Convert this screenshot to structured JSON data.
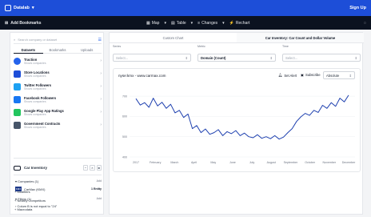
{
  "topbar": {
    "brand": "Datalab",
    "signup": "Sign Up"
  },
  "toolbar": {
    "add_bookmarks": "Add Bookmarks",
    "map": "Map",
    "table": "Table",
    "changes": "Changes",
    "rechart": "Rechart"
  },
  "left": {
    "search_placeholder": "Search company or dataset",
    "tabs": [
      "Datasets",
      "Bookmarks",
      "Uploads"
    ],
    "datasets": [
      {
        "title": "Traction",
        "sub": "Shows companies",
        "color": "#2563eb",
        "icon": "traction-icon"
      },
      {
        "title": "Store Locations",
        "sub": "Shows companies",
        "color": "#1d4ed8",
        "icon": "store-location-icon"
      },
      {
        "title": "Twitter Followers",
        "sub": "Shows companies",
        "color": "#1da1f2",
        "icon": "twitter-icon"
      },
      {
        "title": "Facebook Followers",
        "sub": "Shows companies",
        "color": "#1877f2",
        "icon": "facebook-icon"
      },
      {
        "title": "Google Play App Ratings",
        "sub": "Shows companies",
        "color": "#22c55e",
        "icon": "google-play-icon"
      },
      {
        "title": "Government Contracts",
        "sub": "Shows companies",
        "color": "#475569",
        "icon": "government-icon"
      }
    ],
    "current": {
      "title": "Car Inventory"
    },
    "companies_label": "Companies (1)",
    "add": "Add",
    "company_ticker": "KMX",
    "company_name": "CarMax (KMX)",
    "company_count": "1 Entity",
    "filters_label": "Filters (1)",
    "filter_rule": "Colum B is not equal to \"24\"",
    "modifiers": "Modifiers",
    "nearby": "Nearby Competitors",
    "macro": "Macrodata"
  },
  "main": {
    "tabs": [
      "Custom Chart",
      "Car Inventory: Car Count and Dollar Volume"
    ],
    "series_label": "Series",
    "metric_label": "Metric",
    "time_label": "Time",
    "series_value": "Select...",
    "metric_value": "Domain (Count)",
    "time_value": "Select...",
    "chart_title": "nyse:kmx - www.carmax.com",
    "set_alert": "Set Alert",
    "subscribe": "Subscribe",
    "mode": "Absolute"
  },
  "chart_data": {
    "type": "line",
    "x": [
      "2017",
      "February",
      "March",
      "April",
      "May",
      "June",
      "July",
      "August",
      "September",
      "October",
      "November",
      "December"
    ],
    "yticks": [
      400,
      500,
      600,
      700
    ],
    "ylim": [
      400,
      740
    ],
    "color": "#1e40af",
    "values": [
      688,
      656,
      668,
      645,
      690,
      652,
      670,
      640,
      660,
      618,
      630,
      595,
      612,
      540,
      555,
      520,
      538,
      512,
      520,
      535,
      505,
      525,
      515,
      530,
      505,
      518,
      500,
      495,
      510,
      492,
      500,
      490,
      505,
      488,
      498,
      520,
      540,
      575,
      598,
      615,
      605,
      630,
      620,
      655,
      640,
      668,
      650,
      690,
      672,
      705
    ]
  }
}
